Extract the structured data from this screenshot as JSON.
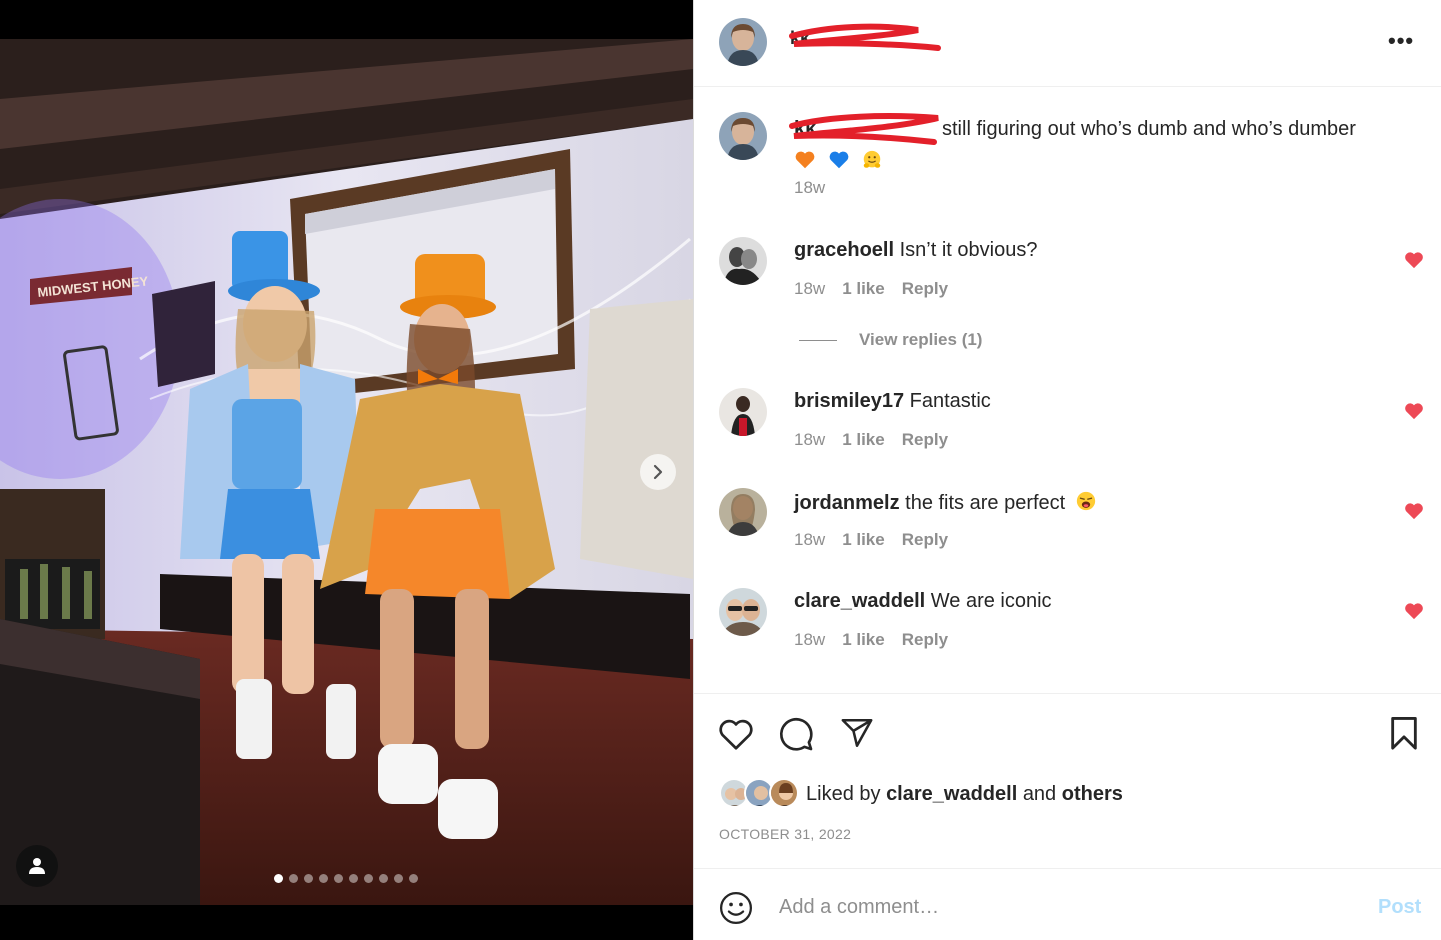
{
  "post": {
    "author": "kk",
    "more_label": "•••",
    "caption_text": "still figuring out who’s dumb and who’s dumber",
    "caption_emojis": [
      "orange-heart",
      "blue-heart",
      "hugging-face"
    ],
    "caption_time": "18w",
    "media_pages": 10,
    "media_active_page": 1
  },
  "comments": [
    {
      "user": "gracehoell",
      "text": "Isn’t it obvious?",
      "time": "18w",
      "likes": "1 like",
      "reply": "Reply"
    },
    {
      "user": "brismiley17",
      "text": "Fantastic",
      "time": "18w",
      "likes": "1 like",
      "reply": "Reply"
    },
    {
      "user": "jordanmelz",
      "text": "the fits are perfect",
      "emoji": "weary-face",
      "time": "18w",
      "likes": "1 like",
      "reply": "Reply"
    },
    {
      "user": "clare_waddell",
      "text": "We are iconic",
      "time": "18w",
      "likes": "1 like",
      "reply": "Reply"
    }
  ],
  "view_replies": "View replies (1)",
  "likes": {
    "prefix": "Liked by",
    "user": "clare_waddell",
    "and": "and",
    "others": "others"
  },
  "date": "OCTOBER 31, 2022",
  "comment_box": {
    "placeholder": "Add a comment…",
    "post_label": "Post"
  },
  "colors": {
    "like_red": "#ed4956",
    "post_disabled": "#b2dffc",
    "secondary_text": "#8e8e8e",
    "scribble_red": "#e3202a"
  }
}
